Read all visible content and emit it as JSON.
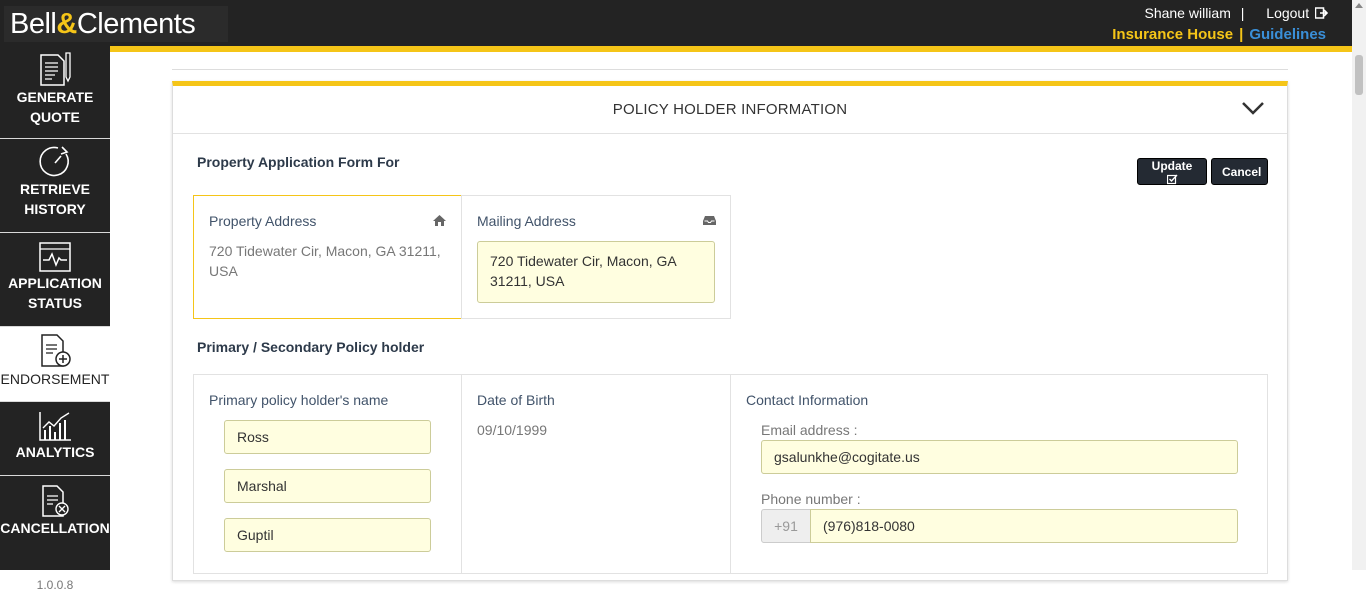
{
  "brand": {
    "name_part1": "Bell",
    "amp": "&",
    "name_part2": "Clements"
  },
  "header": {
    "user_name": "Shane william",
    "separator": "|",
    "logout_label": "Logout",
    "company_link": "Insurance House",
    "link_separator": "|",
    "guidelines_link": "Guidelines"
  },
  "sidebar": {
    "items": [
      {
        "line1": "GENERATE",
        "line2": "QUOTE",
        "icon": "document-edit-icon"
      },
      {
        "line1": "RETRIEVE",
        "line2": "HISTORY",
        "icon": "history-clock-icon"
      },
      {
        "line1": "APPLICATION",
        "line2": "STATUS",
        "icon": "status-monitor-icon"
      },
      {
        "line1": "ENDORSEMENT",
        "line2": "",
        "icon": "document-add-icon"
      },
      {
        "line1": "ANALYTICS",
        "line2": "",
        "icon": "chart-icon"
      },
      {
        "line1": "CANCELLATION",
        "line2": "",
        "icon": "document-cancel-icon"
      }
    ],
    "version": "1.0.0.8"
  },
  "panel": {
    "title": "POLICY HOLDER INFORMATION",
    "form_title": "Property Application Form For",
    "update_label": "Update",
    "cancel_label": "Cancel",
    "property_address": {
      "label": "Property Address",
      "value": "720 Tidewater Cir, Macon, GA 31211, USA"
    },
    "mailing_address": {
      "label": "Mailing Address",
      "value": "720 Tidewater Cir, Macon, GA 31211, USA"
    },
    "policy_holder_title": "Primary / Secondary Policy holder",
    "primary_name": {
      "label": "Primary policy holder's name",
      "first": "Ross",
      "middle": "Marshal",
      "last": "Guptil"
    },
    "dob": {
      "label": "Date of Birth",
      "value": "09/10/1999"
    },
    "contact": {
      "label": "Contact Information",
      "email_label": "Email address :",
      "email": "gsalunkhe@cogitate.us",
      "phone_label": "Phone number :",
      "phone_prefix": "+91",
      "phone": "(976)818-0080"
    }
  },
  "colors": {
    "accent": "#f5c518",
    "dark": "#232323",
    "link_blue": "#3a8fd8",
    "input_bg": "#fffee0"
  }
}
